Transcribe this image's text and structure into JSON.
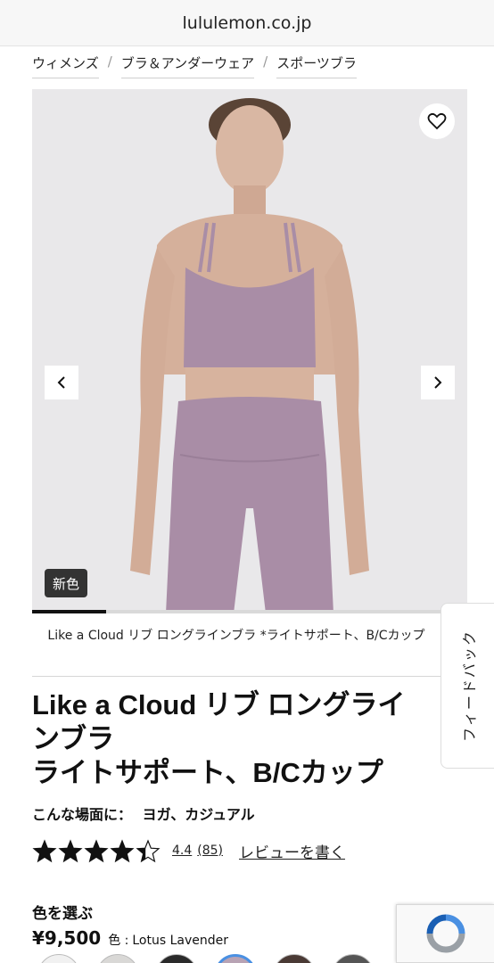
{
  "browser": {
    "url": "lululemon.co.jp"
  },
  "breadcrumbs": [
    "ウィメンズ",
    "ブラ＆アンダーウェア",
    "スポーツブラ"
  ],
  "gallery": {
    "badge": "新色",
    "progress_fraction": 0.17
  },
  "caption": "Like a Cloud リブ ロングラインブラ *ライトサポート、B/Cカップ",
  "product": {
    "title_line1": "Like a Cloud リブ ロングライ",
    "title_line2": "ンブラ",
    "title_line3": "ライトサポート、B/Cカップ",
    "activity_label": "こんな場面に：",
    "activity_value": "ヨガ、カジュアル"
  },
  "rating": {
    "stars": 4.4,
    "value": "4.4",
    "count": "(85)",
    "write_review": "レビューを書く"
  },
  "color": {
    "heading": "色を選ぶ",
    "price": "¥9,500",
    "label": "色 :",
    "name": "Lotus Lavender",
    "swatch_colors": [
      "#f1f1f1",
      "#d9d8d6",
      "#2a2a2a",
      "#b8a3b4",
      "#4a3a35",
      "#555555"
    ]
  },
  "feedback": {
    "label": "フィードバック"
  },
  "colors": {
    "bra": "#a98da6",
    "background": "#e9e8ea",
    "skin": "#d9b7a3"
  }
}
